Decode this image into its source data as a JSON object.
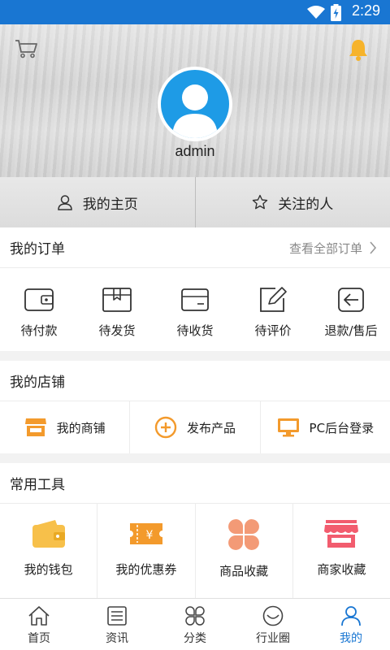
{
  "status_bar": {
    "time": "2:29",
    "background": "#1976d2"
  },
  "profile": {
    "username": "admin",
    "avatar_color": "#1e9be6"
  },
  "quick_links": [
    {
      "label": "我的主页",
      "icon": "person-icon"
    },
    {
      "label": "关注的人",
      "icon": "star-icon"
    }
  ],
  "orders": {
    "title": "我的订单",
    "view_all": "查看全部订单",
    "items": [
      {
        "label": "待付款",
        "icon": "wallet-icon"
      },
      {
        "label": "待发货",
        "icon": "box-icon"
      },
      {
        "label": "待收货",
        "icon": "card-icon"
      },
      {
        "label": "待评价",
        "icon": "edit-icon"
      },
      {
        "label": "退款/售后",
        "icon": "return-icon"
      }
    ]
  },
  "shop": {
    "title": "我的店铺",
    "items": [
      {
        "label": "我的商铺",
        "icon": "store-icon"
      },
      {
        "label": "发布产品",
        "icon": "add-circle-icon"
      },
      {
        "label": "PC后台登录",
        "icon": "monitor-icon"
      }
    ]
  },
  "tools": {
    "title": "常用工具",
    "items": [
      {
        "label": "我的钱包",
        "icon": "purse-icon"
      },
      {
        "label": "我的优惠券",
        "icon": "coupon-icon"
      },
      {
        "label": "商品收藏",
        "icon": "clover-icon"
      },
      {
        "label": "商家收藏",
        "icon": "shop-awning-icon"
      }
    ]
  },
  "tabbar": {
    "active_color": "#1976d2",
    "tabs": [
      {
        "label": "首页",
        "icon": "home-icon"
      },
      {
        "label": "资讯",
        "icon": "news-icon"
      },
      {
        "label": "分类",
        "icon": "category-icon"
      },
      {
        "label": "行业圈",
        "icon": "smile-icon"
      },
      {
        "label": "我的",
        "icon": "user-icon",
        "active": true
      }
    ]
  }
}
